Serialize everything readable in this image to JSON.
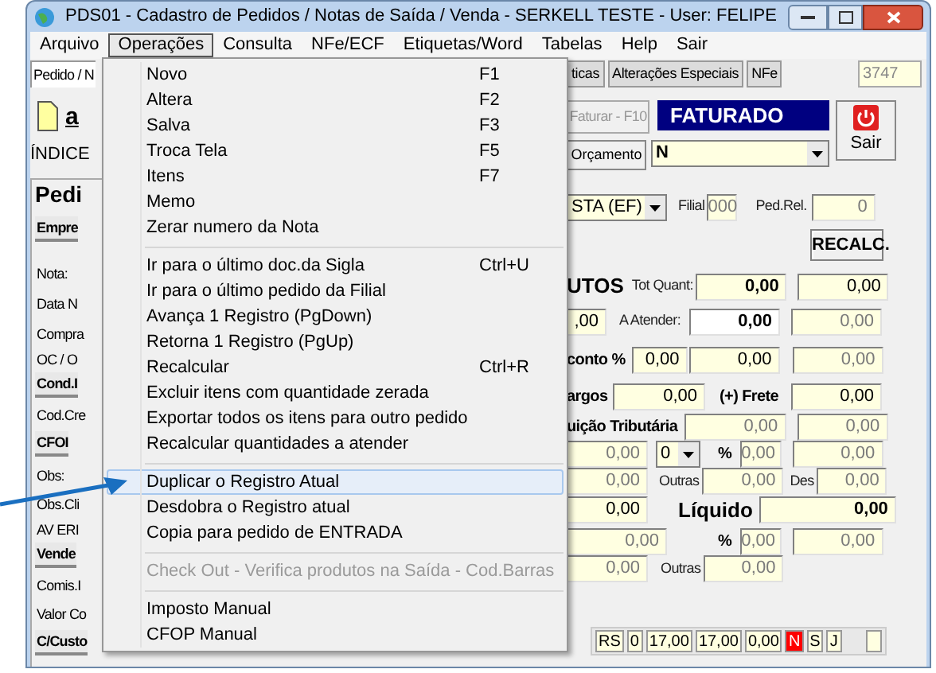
{
  "window": {
    "title": "PDS01 - Cadastro de Pedidos / Notas de Saída / Venda - SERKELL TESTE - User: FELIPE"
  },
  "menu_bar": [
    {
      "label": "Arquivo",
      "selected": false
    },
    {
      "label": "Operações",
      "selected": true
    },
    {
      "label": "Consulta",
      "selected": false
    },
    {
      "label": "NFe/ECF",
      "selected": false
    },
    {
      "label": "Etiquetas/Word",
      "selected": false
    },
    {
      "label": "Tabelas",
      "selected": false
    },
    {
      "label": "Help",
      "selected": false
    },
    {
      "label": "Sair",
      "selected": false
    }
  ],
  "tabs": [
    {
      "label": "Pedido / N",
      "selected": true
    },
    {
      "label": "ticas",
      "selected": false
    },
    {
      "label": "Alterações Especiais",
      "selected": false
    },
    {
      "label": "NFe",
      "selected": false
    }
  ],
  "record_number": "3747",
  "toolbar": {
    "letter_icon": "a",
    "indice_label": "ÍNDICE",
    "faturar": {
      "label": "Faturar - F10",
      "disabled": true
    },
    "status": "FATURADO",
    "sair": "Sair",
    "orcamento": "Orçamento",
    "tipo": "N"
  },
  "left_labels": [
    {
      "kind": "title",
      "text": "Pedi"
    },
    {
      "kind": "section",
      "text": "Empre"
    },
    {
      "kind": "label",
      "text": "Nota:"
    },
    {
      "kind": "label",
      "text": "Data N"
    },
    {
      "kind": "label",
      "text": "Compra"
    },
    {
      "kind": "label",
      "text": "OC / O"
    },
    {
      "kind": "section",
      "text": "Cond.I"
    },
    {
      "kind": "label",
      "text": "Cod.Cre"
    },
    {
      "kind": "section",
      "text": "CFOI"
    },
    {
      "kind": "label",
      "text": "Obs:"
    },
    {
      "kind": "label",
      "text": "Obs.Cli"
    },
    {
      "kind": "label",
      "text": "AV ERI"
    },
    {
      "kind": "section",
      "text": "Vende"
    },
    {
      "kind": "label",
      "text": "Comis.I"
    },
    {
      "kind": "label",
      "text": "Valor Co"
    },
    {
      "kind": "section",
      "text": "C/Custo"
    }
  ],
  "form_rows": [
    {
      "cells": [
        {
          "kind": "combo",
          "value": "STA (EF)"
        },
        {
          "kind": "label",
          "text": "Filial"
        },
        {
          "kind": "field",
          "value": "000",
          "disabled": true
        },
        {
          "kind": "label",
          "text": "Ped.Rel."
        },
        {
          "kind": "field",
          "value": "0",
          "disabled": true
        }
      ]
    },
    {
      "cells": [
        {
          "kind": "button",
          "text": "RECALC."
        }
      ]
    },
    {
      "cells": [
        {
          "kind": "heading",
          "text": "UTOS"
        },
        {
          "kind": "label",
          "text": "Tot Quant:"
        },
        {
          "kind": "field",
          "value": "0,00",
          "bold": true
        },
        {
          "kind": "field",
          "value": "0,00"
        }
      ]
    },
    {
      "cells": [
        {
          "kind": "field",
          "value": ",00"
        },
        {
          "kind": "label",
          "text": "A Atender:"
        },
        {
          "kind": "field",
          "value": "0,00",
          "bold": true,
          "editable": true
        },
        {
          "kind": "field",
          "value": "0,00",
          "disabled": true
        }
      ]
    },
    {
      "cells": [
        {
          "kind": "bold_label",
          "text": "conto %"
        },
        {
          "kind": "field",
          "value": "0,00"
        },
        {
          "kind": "field",
          "value": "0,00"
        },
        {
          "kind": "field",
          "value": "0,00",
          "disabled": true
        }
      ]
    },
    {
      "cells": [
        {
          "kind": "bold_label",
          "text": "argos"
        },
        {
          "kind": "field",
          "value": "0,00"
        },
        {
          "kind": "bold_label",
          "text": "(+) Frete"
        },
        {
          "kind": "field",
          "value": "0,00"
        }
      ]
    },
    {
      "cells": [
        {
          "kind": "bold_label",
          "text": "uição Tributária"
        },
        {
          "kind": "field",
          "value": "0,00",
          "disabled": true
        },
        {
          "kind": "field",
          "value": "0,00",
          "disabled": true
        }
      ]
    },
    {
      "cells": [
        {
          "kind": "field",
          "value": "0,00",
          "disabled": true
        },
        {
          "kind": "combo",
          "value": "0"
        },
        {
          "kind": "bold_label",
          "text": "%"
        },
        {
          "kind": "field",
          "value": "0,00",
          "disabled": true
        },
        {
          "kind": "field",
          "value": "0,00",
          "disabled": true
        }
      ]
    },
    {
      "cells": [
        {
          "kind": "field",
          "value": "0,00",
          "disabled": true
        },
        {
          "kind": "label",
          "text": "Outras"
        },
        {
          "kind": "field",
          "value": "0,00",
          "disabled": true
        },
        {
          "kind": "label",
          "text": "Des"
        },
        {
          "kind": "field",
          "value": "0,00",
          "disabled": true
        }
      ]
    },
    {
      "cells": [
        {
          "kind": "field",
          "value": "0,00"
        },
        {
          "kind": "heading",
          "text": "Líquido"
        },
        {
          "kind": "field",
          "value": "0,00",
          "bold": true
        }
      ]
    },
    {
      "cells": [
        {
          "kind": "field",
          "value": "0,00",
          "disabled": true
        },
        {
          "kind": "bold_label",
          "text": "%"
        },
        {
          "kind": "field",
          "value": "0,00",
          "disabled": true
        },
        {
          "kind": "field",
          "value": "0,00",
          "disabled": true
        }
      ]
    },
    {
      "cells": [
        {
          "kind": "field",
          "value": "0,00",
          "disabled": true
        },
        {
          "kind": "label",
          "text": "Outras"
        },
        {
          "kind": "field",
          "value": "0,00",
          "disabled": true
        }
      ]
    }
  ],
  "status_strip": [
    {
      "value": "RS",
      "alert": false
    },
    {
      "value": "0",
      "alert": false
    },
    {
      "value": "17,00",
      "alert": false
    },
    {
      "value": "17,00",
      "alert": false
    },
    {
      "value": "0,00",
      "alert": false
    },
    {
      "value": "N",
      "alert": true
    },
    {
      "value": "S",
      "alert": false
    },
    {
      "value": "J",
      "alert": false
    }
  ],
  "open_menu": {
    "items": [
      {
        "kind": "item",
        "label": "Novo",
        "shortcut": "F1",
        "highlighted": false,
        "disabled": false
      },
      {
        "kind": "item",
        "label": "Altera",
        "shortcut": "F2",
        "highlighted": false,
        "disabled": false
      },
      {
        "kind": "item",
        "label": "Salva",
        "shortcut": "F3",
        "highlighted": false,
        "disabled": false
      },
      {
        "kind": "item",
        "label": "Troca Tela",
        "shortcut": "F5",
        "highlighted": false,
        "disabled": false
      },
      {
        "kind": "item",
        "label": "Itens",
        "shortcut": "F7",
        "highlighted": false,
        "disabled": false
      },
      {
        "kind": "item",
        "label": "Memo",
        "highlighted": false,
        "disabled": false
      },
      {
        "kind": "item",
        "label": "Zerar numero da Nota",
        "highlighted": false,
        "disabled": false
      },
      {
        "kind": "separator"
      },
      {
        "kind": "item",
        "label": "Ir para o último doc.da Sigla",
        "shortcut": "Ctrl+U",
        "highlighted": false,
        "disabled": false
      },
      {
        "kind": "item",
        "label": "Ir para o último pedido da Filial",
        "highlighted": false,
        "disabled": false
      },
      {
        "kind": "item",
        "label": "Avança 1 Registro (PgDown)",
        "highlighted": false,
        "disabled": false
      },
      {
        "kind": "item",
        "label": "Retorna 1 Registro (PgUp)",
        "highlighted": false,
        "disabled": false
      },
      {
        "kind": "item",
        "label": "Recalcular",
        "shortcut": "Ctrl+R",
        "highlighted": false,
        "disabled": false
      },
      {
        "kind": "item",
        "label": "Excluir itens com quantidade zerada",
        "highlighted": false,
        "disabled": false
      },
      {
        "kind": "item",
        "label": "Exportar todos os itens para outro pedido",
        "highlighted": false,
        "disabled": false
      },
      {
        "kind": "item",
        "label": "Recalcular quantidades a atender",
        "highlighted": false,
        "disabled": false
      },
      {
        "kind": "separator"
      },
      {
        "kind": "item",
        "label": "Duplicar o Registro Atual",
        "highlighted": true,
        "disabled": false
      },
      {
        "kind": "item",
        "label": "Desdobra o Registro atual",
        "highlighted": false,
        "disabled": false
      },
      {
        "kind": "item",
        "label": "Copia para pedido de ENTRADA",
        "highlighted": false,
        "disabled": false
      },
      {
        "kind": "separator"
      },
      {
        "kind": "item",
        "label": "Check Out - Verifica produtos na Saída - Cod.Barras",
        "highlighted": false,
        "disabled": true
      },
      {
        "kind": "separator"
      },
      {
        "kind": "item",
        "label": "Imposto Manual",
        "highlighted": false,
        "disabled": false
      },
      {
        "kind": "item",
        "label": "CFOP Manual",
        "highlighted": false,
        "disabled": false
      }
    ]
  }
}
